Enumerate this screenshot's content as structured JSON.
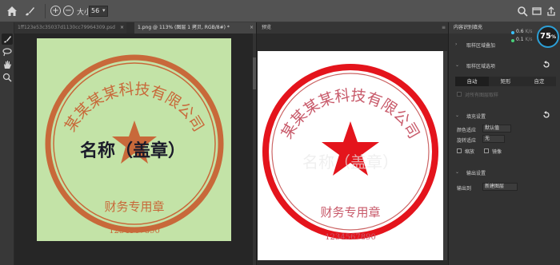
{
  "option_bar": {
    "size_label": "大小",
    "size_value": "56"
  },
  "tabs": [
    {
      "label": "1ff123e53c35037d1130cc79964309.psd",
      "close": "×"
    },
    {
      "label": "1.png @ 113% (图层 1 拷贝, RGB/8#) *",
      "close": "×"
    }
  ],
  "document": {
    "seal_company": "某某某某科技有限公司",
    "seal_overlay": "名称（盖章）",
    "seal_dept": "财务专用章",
    "seal_number": "1234567890"
  },
  "preview_panel": {
    "title": "预览",
    "menu": "≡",
    "seal_company": "某某某某科技有限公司",
    "seal_overlay": "名称（盖章）",
    "seal_dept": "财务专用章",
    "seal_number": "1234567890"
  },
  "properties_panel": {
    "title": "内容识别填充",
    "perf": {
      "v1": "0.6",
      "u1": "K/s",
      "v2": "0.1",
      "u2": "K/s",
      "gauge": "75",
      "gauge_unit": "%"
    },
    "sections": {
      "show_sampling": "取样区域叠加",
      "sampling_options": "取样区域选项",
      "fill_settings": "填充设置",
      "output_settings": "输出设置"
    },
    "sampling_modes": [
      "自动",
      "矩形",
      "自定"
    ],
    "sample_all_layers": "对所有图层取样",
    "color_adapt_label": "颜色适应",
    "color_adapt_value": "默认值",
    "rotate_adapt_label": "旋转适应",
    "rotate_adapt_value": "无",
    "scale_label": "缩放",
    "mirror_label": "镜像",
    "output_to_label": "输出到",
    "output_to_value": "新建图层"
  },
  "colors": {
    "seal_orange": "#c8693a",
    "seal_red": "#e4141c",
    "doc_bg": "#c3e3a7",
    "accent": "#2c9fd6"
  },
  "icons": [
    "home-icon",
    "brush-icon",
    "zoom-in-icon",
    "zoom-out-icon",
    "search-icon",
    "window-icon",
    "share-icon",
    "lasso-icon",
    "hand-icon",
    "zoom-icon",
    "reset-icon"
  ]
}
